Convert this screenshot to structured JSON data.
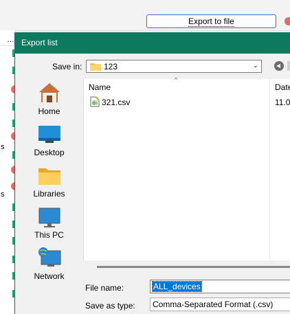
{
  "background": {
    "export_button_label": "Export to file",
    "list_header_ellipsis": "…",
    "row_letters": [
      "s",
      "s"
    ]
  },
  "dialog": {
    "title": "Export list",
    "save_in_label": "Save in:",
    "save_in_value": "123",
    "places": [
      {
        "label": "Home",
        "icon": "home-icon"
      },
      {
        "label": "Desktop",
        "icon": "desktop-icon"
      },
      {
        "label": "Libraries",
        "icon": "libraries-icon"
      },
      {
        "label": "This PC",
        "icon": "this-pc-icon"
      },
      {
        "label": "Network",
        "icon": "network-icon"
      }
    ],
    "columns": {
      "name": "Name",
      "date": "Date"
    },
    "files": [
      {
        "name": "321.csv",
        "date": "11.0"
      }
    ],
    "file_name_label": "File name:",
    "file_name_value": "ALL_devices",
    "save_type_label": "Save as type:",
    "save_type_value": "Comma-Separated Format (.csv)"
  },
  "colors": {
    "titlebar": "#0b7a5f",
    "accent_blue": "#0078d7",
    "status_green": "#1aa37a",
    "status_red": "#e46b6b"
  }
}
